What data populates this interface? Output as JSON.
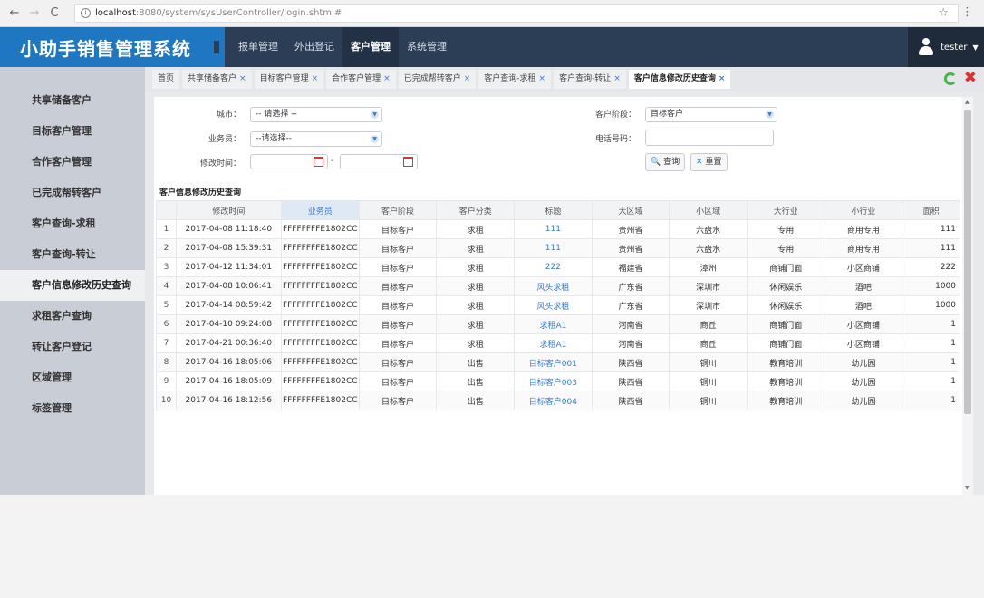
{
  "browser": {
    "back": "←",
    "forward": "→",
    "reload": "C",
    "url_host": "localhost",
    "url_path": ":8080/system/sysUserController/login.shtml#"
  },
  "header": {
    "logo": "小助手销售管理系统",
    "nav": [
      "报单管理",
      "外出登记",
      "客户管理",
      "系统管理"
    ],
    "active_nav": 2,
    "user": "tester"
  },
  "sidebar": {
    "items": [
      "共享储备客户",
      "目标客户管理",
      "合作客户管理",
      "已完成帮转客户",
      "客户查询-求租",
      "客户查询-转让",
      "客户信息修改历史查询",
      "求租客户查询",
      "转让客户登记",
      "区域管理",
      "标签管理"
    ],
    "active_index": 6
  },
  "tabs": {
    "items": [
      {
        "label": "首页",
        "closable": false
      },
      {
        "label": "共享储备客户",
        "closable": true
      },
      {
        "label": "目标客户管理",
        "closable": true
      },
      {
        "label": "合作客户管理",
        "closable": true
      },
      {
        "label": "已完成帮转客户",
        "closable": true
      },
      {
        "label": "客户查询-求租",
        "closable": true
      },
      {
        "label": "客户查询-转让",
        "closable": true
      },
      {
        "label": "客户信息修改历史查询",
        "closable": true
      }
    ],
    "active_index": 7,
    "close_glyph": "×"
  },
  "filters": {
    "city_label": "城市：",
    "city_value": "-- 请选择 --",
    "stage_label": "客户阶段：",
    "stage_value": "目标客户",
    "salesman_label": "业务员：",
    "salesman_value": "--请选择--",
    "phone_label": "电话号码：",
    "phone_value": "",
    "time_label": "修改时间：",
    "time_separator": "-",
    "search_button": "查询",
    "reset_button": "重置"
  },
  "table": {
    "title": "客户信息修改历史查询",
    "columns": [
      "",
      "修改时间",
      "业务员",
      "客户阶段",
      "客户分类",
      "标题",
      "大区域",
      "小区域",
      "大行业",
      "小行业",
      "面积"
    ],
    "sorted_column": 2,
    "rows": [
      [
        "1",
        "2017-04-08 11:18:40",
        "FFFFFFFFE1802CC",
        "目标客户",
        "求租",
        "111",
        "贵州省",
        "六盘水",
        "专用",
        "商用专用",
        "111"
      ],
      [
        "2",
        "2017-04-08 15:39:31",
        "FFFFFFFFE1802CC",
        "目标客户",
        "求租",
        "111",
        "贵州省",
        "六盘水",
        "专用",
        "商用专用",
        "111"
      ],
      [
        "3",
        "2017-04-12 11:34:01",
        "FFFFFFFFE1802CC",
        "目标客户",
        "求租",
        "222",
        "福建省",
        "漳州",
        "商铺门面",
        "小区商铺",
        "222"
      ],
      [
        "4",
        "2017-04-08 10:06:41",
        "FFFFFFFFE1802CC",
        "目标客户",
        "求租",
        "风头求租",
        "广东省",
        "深圳市",
        "休闲娱乐",
        "酒吧",
        "1000"
      ],
      [
        "5",
        "2017-04-14 08:59:42",
        "FFFFFFFFE1802CC",
        "目标客户",
        "求租",
        "风头求租",
        "广东省",
        "深圳市",
        "休闲娱乐",
        "酒吧",
        "1000"
      ],
      [
        "6",
        "2017-04-10 09:24:08",
        "FFFFFFFFE1802CC",
        "目标客户",
        "求租",
        "求租A1",
        "河南省",
        "商丘",
        "商铺门面",
        "小区商铺",
        "1"
      ],
      [
        "7",
        "2017-04-21 00:36:40",
        "FFFFFFFFE1802CC",
        "目标客户",
        "求租",
        "求租A1",
        "河南省",
        "商丘",
        "商铺门面",
        "小区商铺",
        "1"
      ],
      [
        "8",
        "2017-04-16 18:05:06",
        "FFFFFFFFE1802CC",
        "目标客户",
        "出售",
        "目标客户001",
        "陕西省",
        "铜川",
        "教育培训",
        "幼儿园",
        "1"
      ],
      [
        "9",
        "2017-04-16 18:05:09",
        "FFFFFFFFE1802CC",
        "目标客户",
        "出售",
        "目标客户003",
        "陕西省",
        "铜川",
        "教育培训",
        "幼儿园",
        "1"
      ],
      [
        "10",
        "2017-04-16 18:12:56",
        "FFFFFFFFE1802CC",
        "目标客户",
        "出售",
        "目标客户004",
        "陕西省",
        "铜川",
        "教育培训",
        "幼儿园",
        "1"
      ]
    ]
  },
  "icons": {
    "info": "i",
    "star": "☆",
    "menu": "⋮",
    "search": "🔍",
    "reset": "✕",
    "chevron": "▼",
    "close_all": "✖"
  },
  "colors": {
    "brand_blue": "#1f77c1",
    "header_dark": "#2c3e56",
    "link": "#3a7bd5",
    "sidebar": "#c9ced6"
  }
}
